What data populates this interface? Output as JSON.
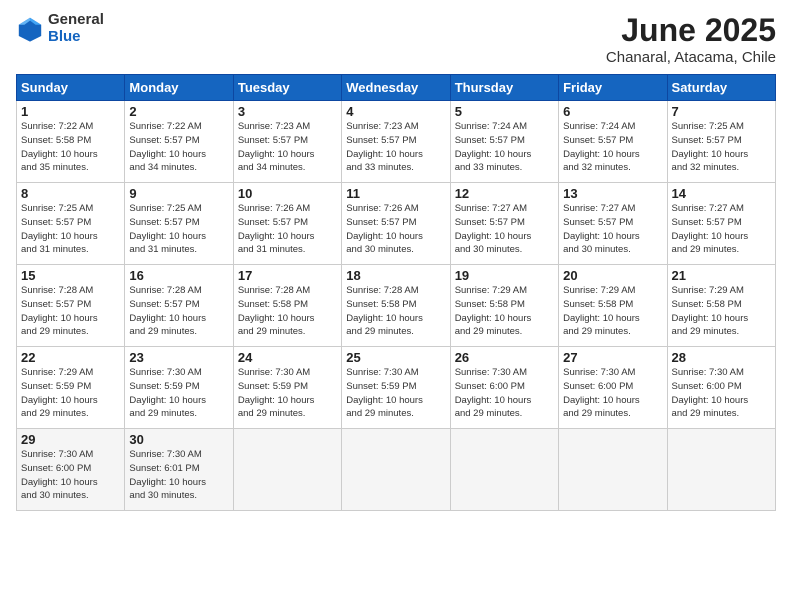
{
  "header": {
    "logo_general": "General",
    "logo_blue": "Blue",
    "title": "June 2025",
    "subtitle": "Chanaral, Atacama, Chile"
  },
  "weekdays": [
    "Sunday",
    "Monday",
    "Tuesday",
    "Wednesday",
    "Thursday",
    "Friday",
    "Saturday"
  ],
  "weeks": [
    [
      {
        "day": "1",
        "info": "Sunrise: 7:22 AM\nSunset: 5:58 PM\nDaylight: 10 hours\nand 35 minutes."
      },
      {
        "day": "2",
        "info": "Sunrise: 7:22 AM\nSunset: 5:57 PM\nDaylight: 10 hours\nand 34 minutes."
      },
      {
        "day": "3",
        "info": "Sunrise: 7:23 AM\nSunset: 5:57 PM\nDaylight: 10 hours\nand 34 minutes."
      },
      {
        "day": "4",
        "info": "Sunrise: 7:23 AM\nSunset: 5:57 PM\nDaylight: 10 hours\nand 33 minutes."
      },
      {
        "day": "5",
        "info": "Sunrise: 7:24 AM\nSunset: 5:57 PM\nDaylight: 10 hours\nand 33 minutes."
      },
      {
        "day": "6",
        "info": "Sunrise: 7:24 AM\nSunset: 5:57 PM\nDaylight: 10 hours\nand 32 minutes."
      },
      {
        "day": "7",
        "info": "Sunrise: 7:25 AM\nSunset: 5:57 PM\nDaylight: 10 hours\nand 32 minutes."
      }
    ],
    [
      {
        "day": "8",
        "info": "Sunrise: 7:25 AM\nSunset: 5:57 PM\nDaylight: 10 hours\nand 31 minutes."
      },
      {
        "day": "9",
        "info": "Sunrise: 7:25 AM\nSunset: 5:57 PM\nDaylight: 10 hours\nand 31 minutes."
      },
      {
        "day": "10",
        "info": "Sunrise: 7:26 AM\nSunset: 5:57 PM\nDaylight: 10 hours\nand 31 minutes."
      },
      {
        "day": "11",
        "info": "Sunrise: 7:26 AM\nSunset: 5:57 PM\nDaylight: 10 hours\nand 30 minutes."
      },
      {
        "day": "12",
        "info": "Sunrise: 7:27 AM\nSunset: 5:57 PM\nDaylight: 10 hours\nand 30 minutes."
      },
      {
        "day": "13",
        "info": "Sunrise: 7:27 AM\nSunset: 5:57 PM\nDaylight: 10 hours\nand 30 minutes."
      },
      {
        "day": "14",
        "info": "Sunrise: 7:27 AM\nSunset: 5:57 PM\nDaylight: 10 hours\nand 29 minutes."
      }
    ],
    [
      {
        "day": "15",
        "info": "Sunrise: 7:28 AM\nSunset: 5:57 PM\nDaylight: 10 hours\nand 29 minutes."
      },
      {
        "day": "16",
        "info": "Sunrise: 7:28 AM\nSunset: 5:57 PM\nDaylight: 10 hours\nand 29 minutes."
      },
      {
        "day": "17",
        "info": "Sunrise: 7:28 AM\nSunset: 5:58 PM\nDaylight: 10 hours\nand 29 minutes."
      },
      {
        "day": "18",
        "info": "Sunrise: 7:28 AM\nSunset: 5:58 PM\nDaylight: 10 hours\nand 29 minutes."
      },
      {
        "day": "19",
        "info": "Sunrise: 7:29 AM\nSunset: 5:58 PM\nDaylight: 10 hours\nand 29 minutes."
      },
      {
        "day": "20",
        "info": "Sunrise: 7:29 AM\nSunset: 5:58 PM\nDaylight: 10 hours\nand 29 minutes."
      },
      {
        "day": "21",
        "info": "Sunrise: 7:29 AM\nSunset: 5:58 PM\nDaylight: 10 hours\nand 29 minutes."
      }
    ],
    [
      {
        "day": "22",
        "info": "Sunrise: 7:29 AM\nSunset: 5:59 PM\nDaylight: 10 hours\nand 29 minutes."
      },
      {
        "day": "23",
        "info": "Sunrise: 7:30 AM\nSunset: 5:59 PM\nDaylight: 10 hours\nand 29 minutes."
      },
      {
        "day": "24",
        "info": "Sunrise: 7:30 AM\nSunset: 5:59 PM\nDaylight: 10 hours\nand 29 minutes."
      },
      {
        "day": "25",
        "info": "Sunrise: 7:30 AM\nSunset: 5:59 PM\nDaylight: 10 hours\nand 29 minutes."
      },
      {
        "day": "26",
        "info": "Sunrise: 7:30 AM\nSunset: 6:00 PM\nDaylight: 10 hours\nand 29 minutes."
      },
      {
        "day": "27",
        "info": "Sunrise: 7:30 AM\nSunset: 6:00 PM\nDaylight: 10 hours\nand 29 minutes."
      },
      {
        "day": "28",
        "info": "Sunrise: 7:30 AM\nSunset: 6:00 PM\nDaylight: 10 hours\nand 29 minutes."
      }
    ],
    [
      {
        "day": "29",
        "info": "Sunrise: 7:30 AM\nSunset: 6:00 PM\nDaylight: 10 hours\nand 30 minutes."
      },
      {
        "day": "30",
        "info": "Sunrise: 7:30 AM\nSunset: 6:01 PM\nDaylight: 10 hours\nand 30 minutes."
      },
      {
        "day": "",
        "info": ""
      },
      {
        "day": "",
        "info": ""
      },
      {
        "day": "",
        "info": ""
      },
      {
        "day": "",
        "info": ""
      },
      {
        "day": "",
        "info": ""
      }
    ]
  ]
}
